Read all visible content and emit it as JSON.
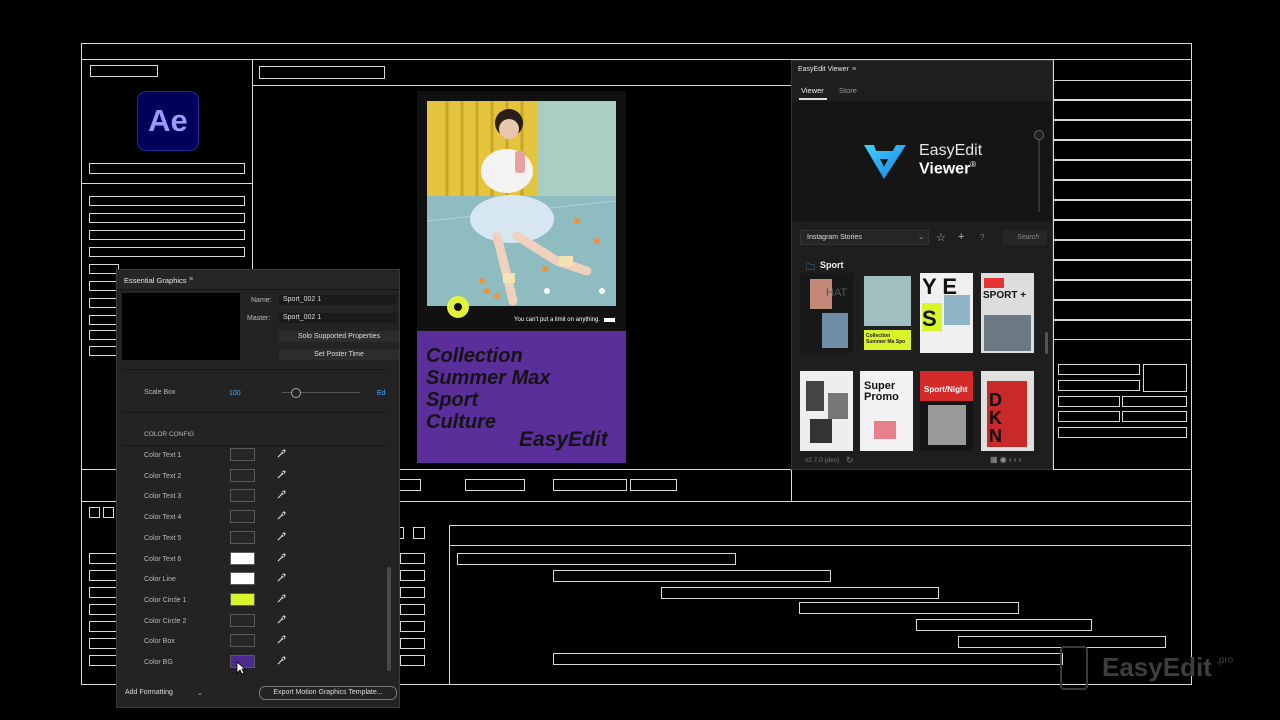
{
  "app": {
    "logo_text": "Ae"
  },
  "essential_graphics": {
    "title": "Essential Graphics",
    "menu": "≡",
    "name_label": "Name:",
    "name_value": "Sport_002 1",
    "master_label": "Master:",
    "master_value": "Sport_002 1",
    "solo_button": "Solo Supported Properties",
    "poster_button": "Set Poster Time",
    "scale_label": "Scale Box",
    "scale_value": "100",
    "scale_edit": "Ed",
    "section_color": "COLOR CONFIG",
    "colors": [
      {
        "label": "Color Text 1",
        "swatch": "#262626"
      },
      {
        "label": "Color Text 2",
        "swatch": "#262626"
      },
      {
        "label": "Color Text 3",
        "swatch": "#262626"
      },
      {
        "label": "Color Text 4",
        "swatch": "#262626"
      },
      {
        "label": "Color Text 5",
        "swatch": "#262626"
      },
      {
        "label": "Color Text 6",
        "swatch": "#ffffff"
      },
      {
        "label": "Color Line",
        "swatch": "#ffffff"
      },
      {
        "label": "Color Circle 1",
        "swatch": "#d8f52a"
      },
      {
        "label": "Color Circle 2",
        "swatch": "#262626"
      },
      {
        "label": "Color Box",
        "swatch": "#262626"
      },
      {
        "label": "Color BG",
        "swatch": "#4b2a90"
      }
    ],
    "add_formatting": "Add Formatting",
    "export_button": "Export Motion Graphics Template..."
  },
  "preview": {
    "tagline": "You can't put a limit on anything.",
    "lines": [
      "Collection",
      "Summer Max",
      "Sport",
      "Culture"
    ],
    "brand": "EasyEdit",
    "colors": {
      "circle": "#e2f339",
      "bg": "#5a2f9a"
    }
  },
  "viewer": {
    "title": "EasyEdit Viewer",
    "menu": "≡",
    "tabs": [
      "Viewer",
      "Store"
    ],
    "logo_line1": "EasyEdit",
    "logo_line2": "Viewer",
    "reg": "®",
    "select_value": "Instagram Stories",
    "search_placeholder": "Search",
    "category": "Sport",
    "tiles": [
      {
        "label": "HAT"
      },
      {
        "label": "Collection Summer Ma Spo"
      },
      {
        "label": "Y E S"
      },
      {
        "label": "SPORT +"
      },
      {
        "label": ""
      },
      {
        "label": "Super Promo"
      },
      {
        "label": "Sport/Night"
      },
      {
        "label": "DKN"
      }
    ],
    "version": "v2.7.0 (dev)"
  },
  "watermark": {
    "text": "EasyEdit",
    "suffix": ".pro"
  }
}
